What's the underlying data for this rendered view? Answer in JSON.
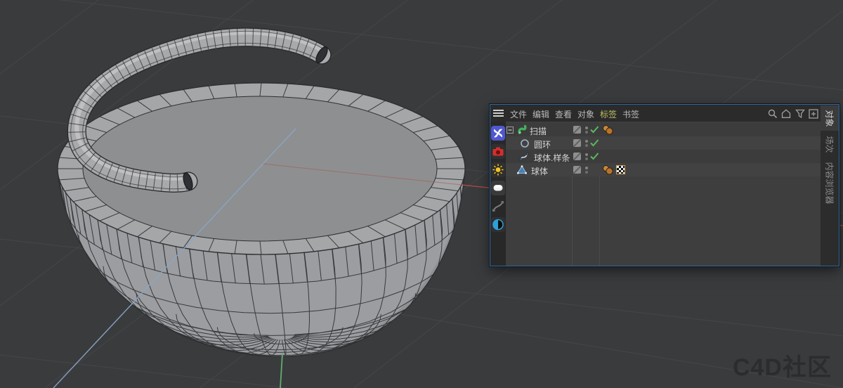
{
  "watermark": {
    "text": "C4D社区"
  },
  "viewport": {
    "background": "#3a3b3d",
    "axes": {
      "x_color": "#bf4f45",
      "y_color": "#5fae6e",
      "z_color": "#8aa6c6"
    },
    "model": "hemisphere bowl with swept spiral tube, wireframe shading"
  },
  "panel": {
    "menu": {
      "items": [
        {
          "label": "文件"
        },
        {
          "label": "编辑"
        },
        {
          "label": "查看"
        },
        {
          "label": "对象"
        },
        {
          "label": "标签",
          "highlighted": true
        },
        {
          "label": "书签"
        }
      ],
      "highlight_color": "#bdbd66"
    },
    "toolbar": {
      "icons": [
        "search",
        "home",
        "filter",
        "add"
      ]
    },
    "palette": {
      "icons": [
        "menu",
        "pinwheel",
        "camera",
        "sun",
        "light-pill",
        "spline",
        "contrast"
      ]
    },
    "side_tabs": {
      "tabs": [
        {
          "label": "对象",
          "active": true
        },
        {
          "label": "场次",
          "active": false
        },
        {
          "label": "内容浏览器",
          "active": false
        }
      ]
    },
    "tree": {
      "rows": [
        {
          "label": "扫描",
          "icon": "sweep",
          "expanded": true,
          "visible_check": true,
          "tags": [
            "phong"
          ]
        },
        {
          "label": "圆环",
          "icon": "circle-spline",
          "visible_check": true,
          "tags": []
        },
        {
          "label": "球体.样条",
          "icon": "spline",
          "visible_check": true,
          "tags": []
        },
        {
          "label": "球体",
          "icon": "polygon-sphere",
          "visible_check": false,
          "tags": [
            "phong",
            "texture"
          ]
        }
      ],
      "check_color": "#5cb85c",
      "tag_color": "#bf7a33"
    }
  }
}
